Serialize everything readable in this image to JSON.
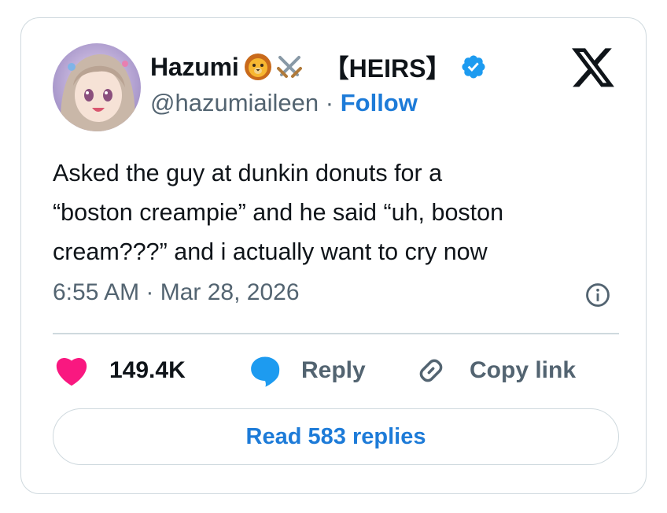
{
  "author": {
    "display_name": "Hazumi",
    "name_emojis": [
      "lion-face-icon",
      "crossed-swords-icon"
    ],
    "tag": "【HEIRS】",
    "handle": "@hazumiaileen",
    "separator": "·",
    "follow_label": "Follow",
    "verified": true
  },
  "tweet": {
    "text": "Asked the guy at dunkin donuts for a\n“boston creampie” and he said “uh, boston\ncream???” and i actually want to cry now",
    "time": "6:55 AM",
    "date": "Mar 28, 2026",
    "time_separator": "·"
  },
  "actions": {
    "like_count": "149.4K",
    "reply_label": "Reply",
    "copy_label": "Copy link"
  },
  "read_replies_label": "Read 583 replies",
  "colors": {
    "accent_blue": "#1d7bd8",
    "like_pink": "#f91880",
    "border": "#cfd9de",
    "muted_text": "#536471",
    "verified_blue": "#1d9bf0"
  }
}
